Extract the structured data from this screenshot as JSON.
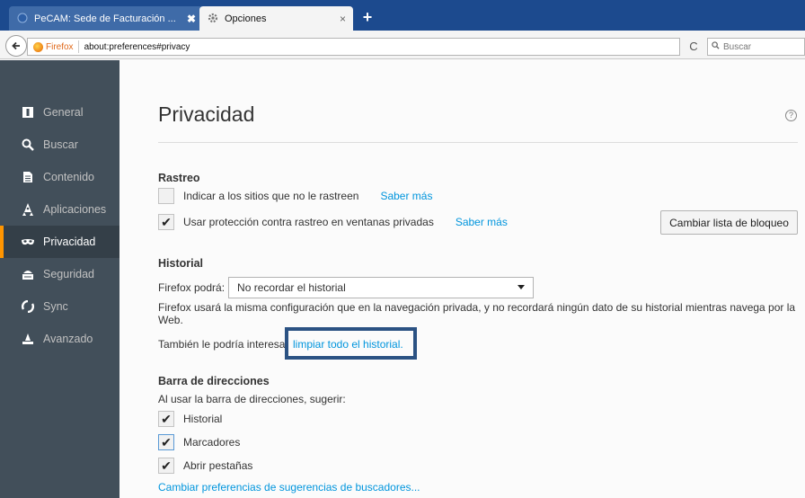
{
  "browser": {
    "tabs": [
      {
        "title": "PeCAM: Sede de Facturación ...",
        "close": "✖"
      },
      {
        "title": "Opciones",
        "close": "×"
      }
    ],
    "new_tab": "+",
    "identity": "Firefox",
    "url": "about:preferences#privacy",
    "reload": "C",
    "search_placeholder": "Buscar"
  },
  "sidebar": {
    "items": [
      {
        "label": "General",
        "icon": "general-icon"
      },
      {
        "label": "Buscar",
        "icon": "search-icon"
      },
      {
        "label": "Contenido",
        "icon": "content-icon"
      },
      {
        "label": "Aplicaciones",
        "icon": "applications-icon"
      },
      {
        "label": "Privacidad",
        "icon": "privacy-mask-icon",
        "selected": true
      },
      {
        "label": "Seguridad",
        "icon": "security-icon"
      },
      {
        "label": "Sync",
        "icon": "sync-icon"
      },
      {
        "label": "Avanzado",
        "icon": "advanced-icon"
      }
    ]
  },
  "page": {
    "title": "Privacidad",
    "help": "?",
    "tracking": {
      "heading": "Rastreo",
      "dnt_label": "Indicar a los sitios que no le rastreen",
      "dnt_checked": false,
      "learn_more": "Saber más",
      "private_label": "Usar protección contra rastreo en ventanas privadas",
      "private_checked": true,
      "learn_more_2": "Saber más",
      "block_list_button": "Cambiar lista de bloqueo"
    },
    "history": {
      "heading": "Historial",
      "firefox_will": "Firefox podrá:",
      "mode_selected": "No recordar el historial",
      "description": "Firefox usará la misma configuración que en la navegación privada, y no recordará ningún dato de su historial mientras navega por la Web.",
      "also_interest": "También le podría interesa",
      "clear_link": "limpiar todo el historial",
      "clear_link_suffix": "."
    },
    "address_bar": {
      "heading": "Barra de direcciones",
      "intro": "Al usar la barra de direcciones, sugerir:",
      "options": [
        {
          "label": "Historial",
          "checked": true
        },
        {
          "label": "Marcadores",
          "checked": true
        },
        {
          "label": "Abrir pestañas",
          "checked": true
        }
      ],
      "change_link": "Cambiar preferencias de sugerencias de buscadores..."
    },
    "check_mark": "✔"
  },
  "colors": {
    "tabbar": "#1c4a8e",
    "sidebar": "#424f5a",
    "sidebar_selected": "#343f48",
    "accent_orange": "#ff9500",
    "link": "#0095dd",
    "highlight_box": "#2b5283"
  }
}
